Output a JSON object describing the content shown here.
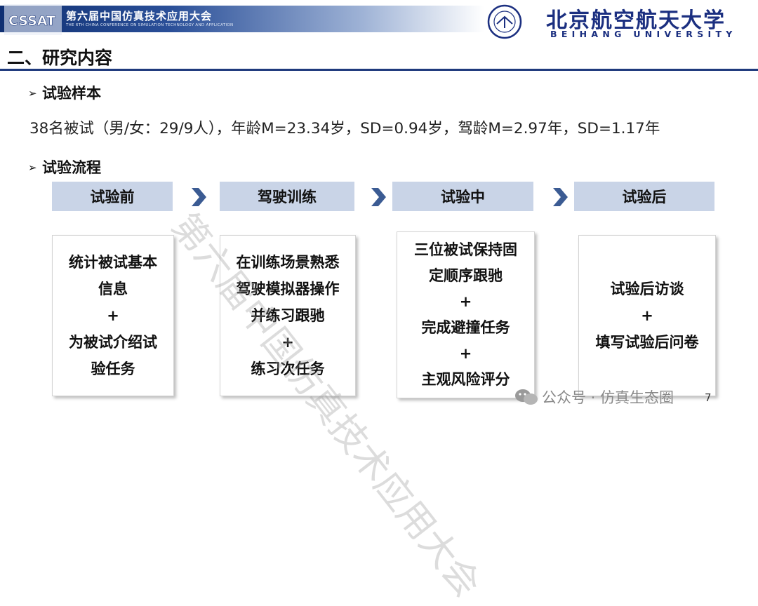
{
  "header": {
    "conference_title": "第六届中国仿真技术应用大会",
    "conference_subtitle": "THE 6TH CHINA CONFERENCE ON SIMULATION TECHNOLOGY AND APPLICATION",
    "logo_text": "CSSAT",
    "university_cn": "北京航空航天大学",
    "university_en": "BEIHANG UNIVERSITY"
  },
  "section_title": "二、研究内容",
  "sample": {
    "heading": "试验样本",
    "text": "38名被试（男/女：29/9人），年龄M=23.34岁，SD=0.94岁，驾龄M=2.97年，SD=1.17年"
  },
  "process": {
    "heading": "试验流程",
    "steps": [
      {
        "title": "试验前",
        "lines": [
          "统计被试基本",
          "信息",
          "+",
          "为被试介绍试",
          "验任务"
        ]
      },
      {
        "title": "驾驶训练",
        "lines": [
          "在训练场景熟悉",
          "驾驶模拟器操作",
          "并练习跟驰",
          "+",
          "练习次任务"
        ]
      },
      {
        "title": "试验中",
        "lines": [
          "三位被试保持固",
          "定顺序跟驰",
          "+",
          "完成避撞任务",
          "+",
          "主观风险评分"
        ]
      },
      {
        "title": "试验后",
        "lines": [
          "试验后访谈",
          "+",
          "填写试验后问卷"
        ]
      }
    ]
  },
  "watermark": "第六届中国仿真技术应用大会",
  "wechat_label": "公众号 · 仿真生态圈",
  "page_number": "7",
  "colors": {
    "navy": "#1f3a7d",
    "step_head_bg": "#c9d4e7",
    "chevron": "#3b5b93"
  }
}
